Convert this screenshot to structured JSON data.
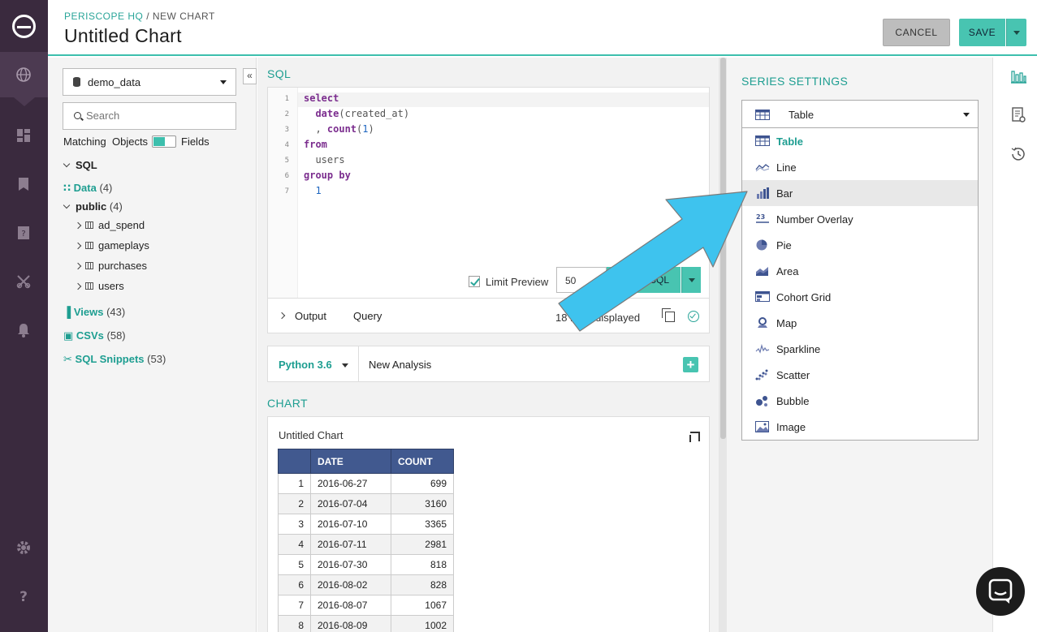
{
  "header": {
    "breadcrumb_root": "PERISCOPE HQ",
    "breadcrumb_sep": " / ",
    "breadcrumb_current": "NEW CHART",
    "title": "Untitled Chart",
    "cancel_label": "CANCEL",
    "save_label": "SAVE"
  },
  "leftnav": {
    "icons": [
      "logo-icon",
      "globe-icon",
      "dashboard-icon",
      "bookmark-icon",
      "report-icon",
      "tools-icon",
      "bell-icon",
      "gear-icon",
      "help-icon"
    ]
  },
  "schema": {
    "database": "demo_data",
    "collapse_label": "«",
    "search_placeholder": "Search",
    "matching_label": "Matching",
    "objects_label": "Objects",
    "fields_label": "Fields",
    "sql_label": "SQL",
    "data_label": "Data",
    "data_count": "(4)",
    "public_label": "public",
    "public_count": "(4)",
    "tables": [
      "ad_spend",
      "gameplays",
      "purchases",
      "users"
    ],
    "views_label": "Views",
    "views_count": "(43)",
    "csvs_label": "CSVs",
    "csvs_count": "(58)",
    "snippets_label": "SQL Snippets",
    "snippets_count": "(53)"
  },
  "editor": {
    "section_title": "SQL",
    "line_numbers": [
      "1",
      "2",
      "3",
      "4",
      "5",
      "6",
      "7"
    ],
    "limit_preview_label": "Limit Preview",
    "limit_value": "50",
    "run_label": "SQL"
  },
  "output": {
    "output_tab": "Output",
    "query_tab": "Query",
    "rows_displayed": "18 rows displayed"
  },
  "python": {
    "version": "Python 3.6",
    "analysis_name": "New Analysis",
    "add_label": "+"
  },
  "chart": {
    "section_title": "CHART",
    "title": "Untitled Chart",
    "columns": [
      "",
      "DATE",
      "COUNT"
    ],
    "rows": [
      [
        "1",
        "2016-06-27",
        "699"
      ],
      [
        "2",
        "2016-07-04",
        "3160"
      ],
      [
        "3",
        "2016-07-10",
        "3365"
      ],
      [
        "4",
        "2016-07-11",
        "2981"
      ],
      [
        "5",
        "2016-07-30",
        "818"
      ],
      [
        "6",
        "2016-08-02",
        "828"
      ],
      [
        "7",
        "2016-08-07",
        "1067"
      ],
      [
        "8",
        "2016-08-09",
        "1002"
      ]
    ]
  },
  "series_settings": {
    "title": "SERIES SETTINGS",
    "selected": "Table",
    "options": [
      "Table",
      "Line",
      "Bar",
      "Number Overlay",
      "Pie",
      "Area",
      "Cohort Grid",
      "Map",
      "Sparkline",
      "Scatter",
      "Bubble",
      "Image"
    ],
    "hovered": "Bar"
  },
  "colors": {
    "accent": "#48c4b1",
    "nav_bg": "#3a2a3e",
    "table_header": "#41598f",
    "arrow": "#3ec3ee"
  }
}
